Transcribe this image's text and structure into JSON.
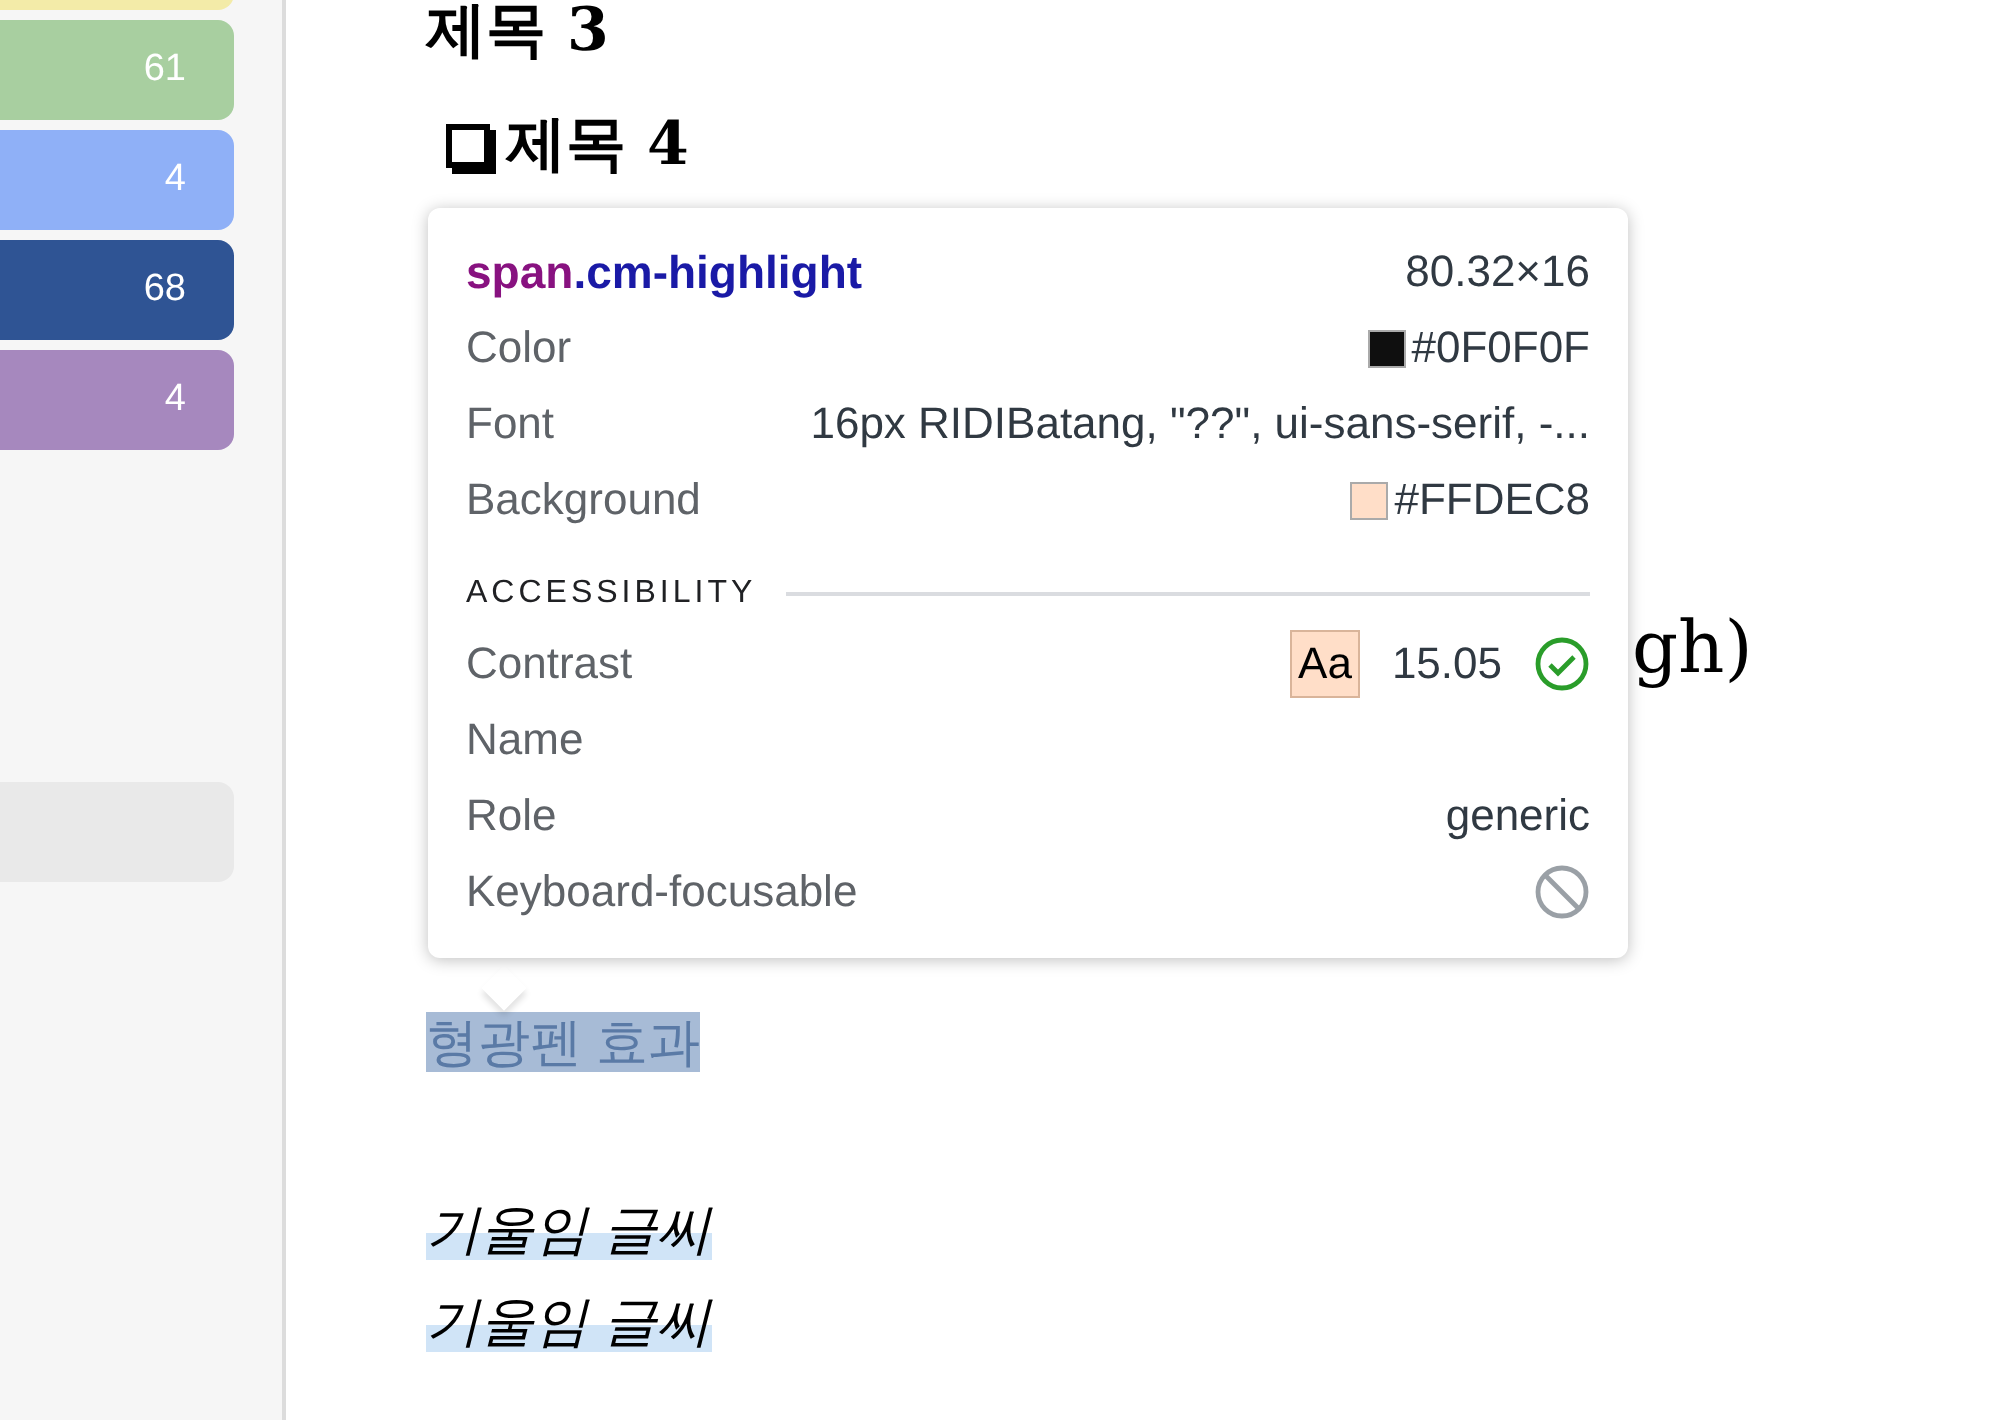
{
  "sidebar": {
    "tags": [
      {
        "color": "#f3eba8"
      },
      {
        "count": "61",
        "color": "#a8cfa0"
      },
      {
        "count": "4",
        "color": "#8fb0f7"
      },
      {
        "count": "68",
        "color": "#2f5494"
      },
      {
        "count": "4",
        "color": "#a688be"
      }
    ]
  },
  "document": {
    "blocks": [
      {
        "kind": "heading",
        "text": "제목 3"
      },
      {
        "kind": "checkbox-heading",
        "text": "제목 4",
        "checked": false
      },
      {
        "kind": "partial",
        "text": "gh)"
      },
      {
        "kind": "highlight",
        "text": "형광펜 효과"
      },
      {
        "kind": "italic",
        "text": "기울임 글씨"
      },
      {
        "kind": "italic",
        "text": "기울임 글씨"
      }
    ]
  },
  "tooltip": {
    "tag": "span",
    "class": ".cm-highlight",
    "size": "80.32×16",
    "rows": [
      {
        "label": "Color",
        "value": "#0F0F0F",
        "color": "#0f0f0f"
      },
      {
        "label": "Font",
        "value": "16px RIDIBatang, \"??\", ui-sans-serif, -..."
      },
      {
        "label": "Background",
        "value": "#FFDEC8",
        "color": "#ffdec8"
      }
    ],
    "section": "ACCESSIBILITY",
    "accessibility": [
      {
        "kind": "contrast",
        "label": "Contrast",
        "sample": "Aa",
        "value": "15.05",
        "passes": true
      },
      {
        "kind": "text",
        "label": "Name"
      },
      {
        "kind": "text",
        "label": "Role",
        "value": "generic"
      },
      {
        "kind": "focusable",
        "label": "Keyboard-focusable",
        "focusable": false
      }
    ]
  }
}
